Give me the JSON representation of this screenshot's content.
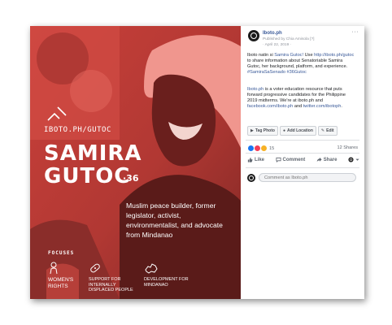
{
  "poster": {
    "site_url": "IBOTO.PH/GUTOC",
    "name_line1": "SAMIRA",
    "name_line2": "GUTOC",
    "ballot_number": "·36",
    "bio": "Muslim peace builder, former legislator, activist, environmentalist, and advocate from Mindanao",
    "focuses_label": "FOCUSES",
    "focuses": [
      {
        "label": "WOMEN'S RIGHTS",
        "icon": "woman-icon"
      },
      {
        "label": "SUPPORT FOR INTERNALLY DISPLACED PEOPLE",
        "icon": "bandage-icon"
      },
      {
        "label": "DEVELOPMENT FOR MINDANAO",
        "icon": "mindanao-map-icon"
      }
    ],
    "colors": {
      "overlay": "#d4443c",
      "dark": "#6e2422"
    }
  },
  "post": {
    "page_name": "Iboto.ph",
    "published_by": "Published by Chia Amisola [?]",
    "date": "· April 22, 2019 ·",
    "more_icon": "···",
    "p1_a": "Iboto natin si ",
    "p1_mention": "Samira Gutoc!",
    "p1_b": " Use ",
    "p1_link": "http://iboto.ph/gutoc",
    "p1_c": " to share information about Senatoriable Samira Gutoc, her background, platform, and experience.",
    "p1_tags": "#SamiraSaSenado #36Gutoc",
    "p2_mention": "Iboto.ph",
    "p2_a": " is a voter education resource that puts forward progressive candidates for the Philippine 2019 midterms. We're at iboto.ph and ",
    "p2_link1": "facebook.com/iboto.ph",
    "p2_b": " and ",
    "p2_link2": "twitter.com/ibotoph",
    "p2_c": ".",
    "tag_photo": "Tag Photo",
    "add_location": "Add Location",
    "edit": "Edit",
    "reaction_count": "15",
    "shares": "12 Shares",
    "like": "Like",
    "comment": "Comment",
    "share": "Share",
    "comment_placeholder": "Comment as Iboto.ph",
    "colors": {
      "link": "#385898",
      "muted": "#606770"
    }
  }
}
